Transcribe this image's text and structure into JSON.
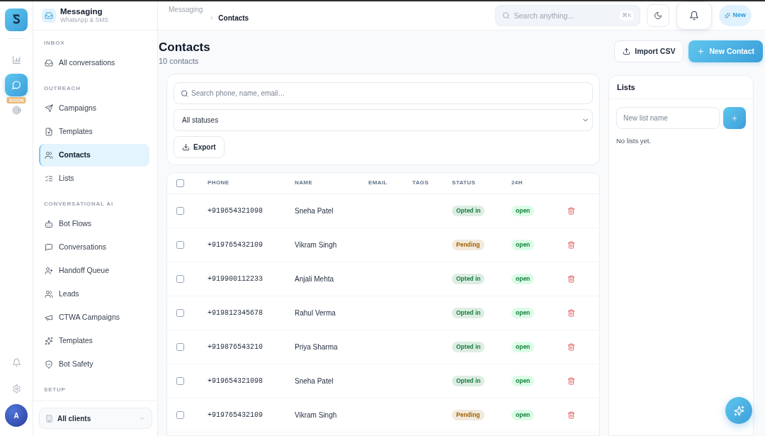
{
  "rail": {
    "items": [
      {
        "selected": false
      },
      {
        "selected": true
      },
      {
        "selected": false,
        "badge": "SOON"
      }
    ],
    "avatar": "A"
  },
  "sidebar": {
    "header": {
      "title": "Messaging",
      "subtitle": "WhatsApp & SMS"
    },
    "sections": [
      {
        "heading": "INBOX",
        "items": [
          {
            "label": "All conversations",
            "selected": false
          }
        ]
      },
      {
        "heading": "OUTREACH",
        "items": [
          {
            "label": "Campaigns",
            "selected": false
          },
          {
            "label": "Templates",
            "selected": false
          },
          {
            "label": "Contacts",
            "selected": true
          },
          {
            "label": "Lists",
            "selected": false
          }
        ]
      },
      {
        "heading": "CONVERSATIONAL AI",
        "items": [
          {
            "label": "Bot Flows",
            "selected": false
          },
          {
            "label": "Conversations",
            "selected": false
          },
          {
            "label": "Handoff Queue",
            "selected": false
          },
          {
            "label": "Leads",
            "selected": false
          },
          {
            "label": "CTWA Campaigns",
            "selected": false
          },
          {
            "label": "Templates",
            "selected": false
          },
          {
            "label": "Bot Safety",
            "selected": false
          }
        ]
      },
      {
        "heading": "SETUP"
      }
    ],
    "client_select": {
      "value": "All clients"
    }
  },
  "topbar": {
    "breadcrumb": [
      "Messaging",
      "Contacts"
    ],
    "search": {
      "placeholder": "Search anything...",
      "shortcut": "⌘K"
    },
    "new_button": "New"
  },
  "page": {
    "title": "Contacts",
    "subtitle": "10 contacts",
    "buttons": [
      {
        "label": "Import CSV",
        "kind": "outline"
      },
      {
        "label": "New Contact",
        "kind": "primary"
      }
    ]
  },
  "filters": {
    "search": {
      "placeholder": "Search phone, name, email…"
    },
    "status_select": {
      "value": "All statuses"
    },
    "export_button": "Export"
  },
  "table": {
    "select_all": {
      "checked": false
    },
    "columns": [
      "PHONE",
      "NAME",
      "EMAIL",
      "TAGS",
      "STATUS",
      "24H"
    ],
    "rows": [
      {
        "checked": false,
        "phone": "+919654321098",
        "name": "Sneha Patel",
        "status": {
          "label": "Opted in",
          "color": "#15803d"
        },
        "window": "open"
      },
      {
        "checked": false,
        "phone": "+919765432109",
        "name": "Vikram Singh",
        "status": {
          "label": "Pending",
          "color": "#a16207"
        },
        "window": "open"
      },
      {
        "checked": false,
        "phone": "+919900112233",
        "name": "Anjali Mehta",
        "status": {
          "label": "Opted in",
          "color": "#15803d"
        },
        "window": "open"
      },
      {
        "checked": false,
        "phone": "+919812345678",
        "name": "Rahul Verma",
        "status": {
          "label": "Opted in",
          "color": "#15803d"
        },
        "window": "open"
      },
      {
        "checked": false,
        "phone": "+919876543210",
        "name": "Priya Sharma",
        "status": {
          "label": "Opted in",
          "color": "#15803d"
        },
        "window": "open"
      },
      {
        "checked": false,
        "phone": "+919654321098",
        "name": "Sneha Patel",
        "status": {
          "label": "Opted in",
          "color": "#15803d"
        },
        "window": "open"
      },
      {
        "checked": false,
        "phone": "+919765432109",
        "name": "Vikram Singh",
        "status": {
          "label": "Pending",
          "color": "#a16207"
        },
        "window": "open"
      }
    ]
  },
  "lists_panel": {
    "title": "Lists",
    "input": {
      "placeholder": "New list name"
    },
    "empty_text": "No lists yet."
  }
}
